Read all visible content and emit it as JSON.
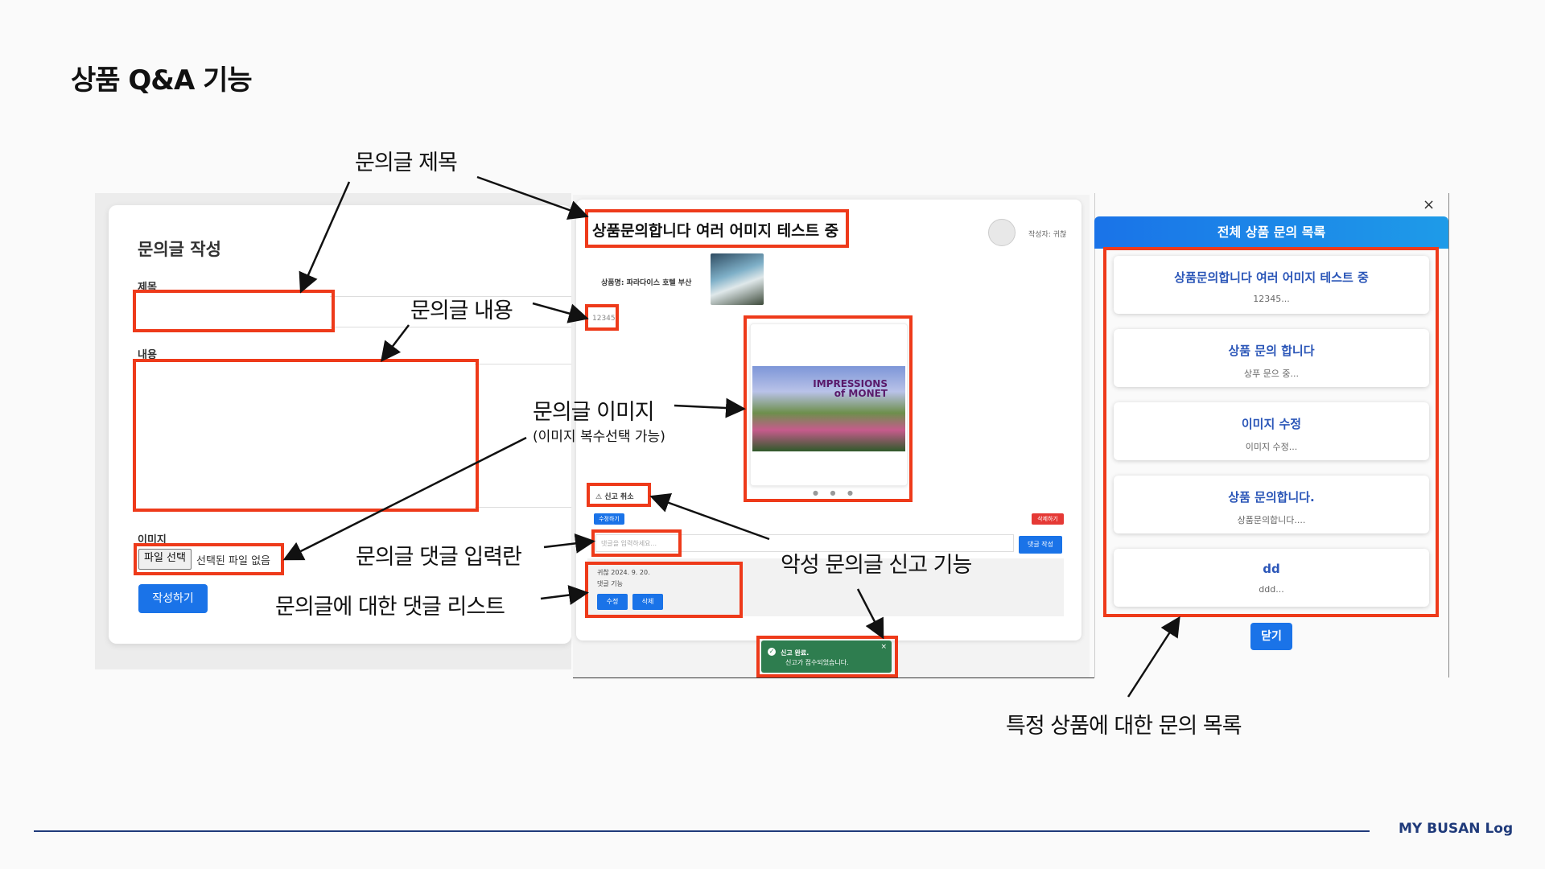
{
  "slide": {
    "title": "상품 Q&A 기능",
    "footer": "MY BUSAN Log"
  },
  "write_form": {
    "heading": "문의글 작성",
    "title_label": "제목",
    "content_label": "내용",
    "image_label": "이미지",
    "file_button": "파일 선택",
    "file_status": "선택된 파일 없음",
    "submit": "작성하기"
  },
  "detail": {
    "title": "상품문의합니다 여러 어미지 테스트 중",
    "author": "작성자: 귀찮",
    "product_name": "상품명: 파라다이스 호텔 부산",
    "content": "12345",
    "poster_text_1": "IMPRESSIONS",
    "poster_text_2": "of MONET",
    "report_cancel": "신고 취소",
    "edit": "수정하기",
    "delete": "삭제하기",
    "comment_placeholder": "댓글을 입력하세요...",
    "comment_submit": "댓글 작성",
    "comment": {
      "meta": "귀찮 2024. 9. 20.",
      "text": "댓글 기능",
      "edit": "수정",
      "delete": "삭제"
    },
    "toast": {
      "title": "신고 완료.",
      "message": "신고가 접수되었습니다.",
      "close": "×"
    }
  },
  "list_modal": {
    "close_x": "×",
    "header": "전체 상품 문의 목록",
    "items": [
      {
        "title": "상품문의합니다 여러 어미지 테스트 중",
        "snippet": "12345..."
      },
      {
        "title": "상품 문의 합니다",
        "snippet": "상푸 문으 중..."
      },
      {
        "title": "이미지 수정",
        "snippet": "이미지 수정..."
      },
      {
        "title": "상품 문의합니다.",
        "snippet": "상품문의합니다...."
      },
      {
        "title": "dd",
        "snippet": "ddd..."
      }
    ],
    "close_button": "닫기"
  },
  "annotations": {
    "title": "문의글 제목",
    "content": "문의글 내용",
    "image": "문의글 이미지",
    "image_sub": "(이미지 복수선택 가능)",
    "comment_input": "문의글 댓글 입력란",
    "comment_list": "문의글에 대한 댓글 리스트",
    "report": "악성 문의글 신고 기능",
    "product_list": "특정 상품에 대한 문의 목록"
  },
  "colors": {
    "highlight": "#ee3a1a",
    "primary": "#1a73e8",
    "danger": "#e53935",
    "toast": "#2e7d4f",
    "brand": "#1f3a7a"
  }
}
